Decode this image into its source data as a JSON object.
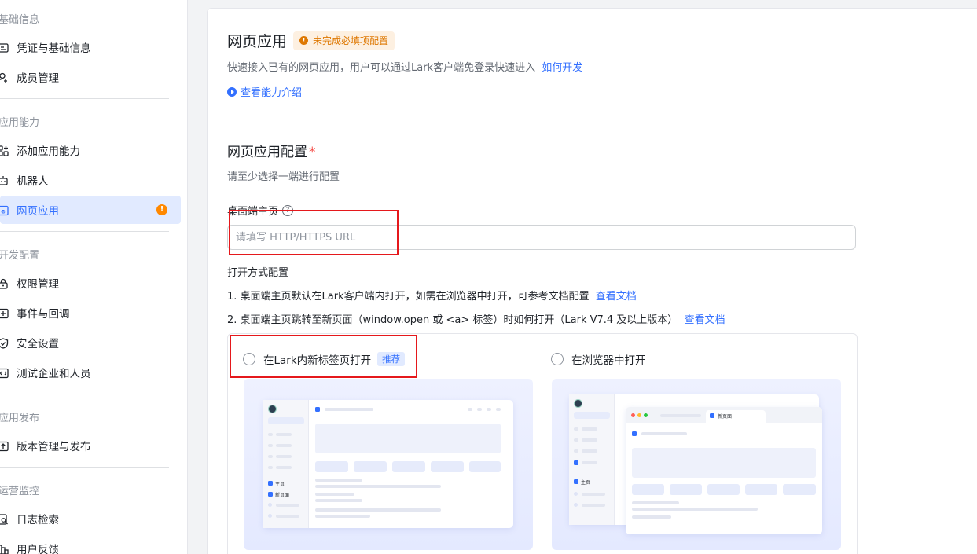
{
  "sidebar": {
    "groups": [
      {
        "title": "基础信息",
        "items": [
          {
            "label": "凭证与基础信息",
            "icon": "credentials-icon"
          },
          {
            "label": "成员管理",
            "icon": "members-icon"
          }
        ]
      },
      {
        "title": "应用能力",
        "items": [
          {
            "label": "添加应用能力",
            "icon": "add-capability-icon"
          },
          {
            "label": "机器人",
            "icon": "robot-icon"
          },
          {
            "label": "网页应用",
            "icon": "web-app-icon",
            "active": true,
            "badge": "!"
          }
        ]
      },
      {
        "title": "开发配置",
        "items": [
          {
            "label": "权限管理",
            "icon": "lock-icon"
          },
          {
            "label": "事件与回调",
            "icon": "event-icon"
          },
          {
            "label": "安全设置",
            "icon": "shield-icon"
          },
          {
            "label": "测试企业和人员",
            "icon": "test-icon"
          }
        ]
      },
      {
        "title": "应用发布",
        "items": [
          {
            "label": "版本管理与发布",
            "icon": "upload-icon"
          }
        ]
      },
      {
        "title": "运营监控",
        "items": [
          {
            "label": "日志检索",
            "icon": "log-search-icon"
          },
          {
            "label": "用户反馈",
            "icon": "feedback-icon"
          }
        ]
      }
    ]
  },
  "main": {
    "title": "网页应用",
    "warning_badge": "未完成必填项配置",
    "description": "快速接入已有的网页应用，用户可以通过Lark客户端免登录快速进入",
    "how_to_dev_link": "如何开发",
    "intro_link": "查看能力介绍",
    "config": {
      "title": "网页应用配置",
      "required_mark": "*",
      "subtitle": "请至少选择一端进行配置",
      "desktop_home_label": "桌面端主页",
      "url_value": "",
      "url_placeholder": "请填写 HTTP/HTTPS URL",
      "open_mode_title": "打开方式配置",
      "note1": "1. 桌面端主页默认在Lark客户端内打开，如需在浏览器中打开，可参考文档配置",
      "note2": "2. 桌面端主页跳转至新页面（window.open 或 <a> 标签）时如何打开（Lark V7.4 及以上版本）",
      "doc_link": "查看文档",
      "options": [
        {
          "label": "在Lark内新标签页打开",
          "tag": "推荐",
          "selected": false
        },
        {
          "label": "在浏览器中打开",
          "selected": false
        }
      ],
      "preview": {
        "home_label": "主页",
        "new_page_label": "新页面",
        "tab_label": "新页面"
      }
    }
  },
  "colors": {
    "accent": "#3370ff",
    "warning": "#ff8800",
    "annotation": "#e5181c"
  }
}
